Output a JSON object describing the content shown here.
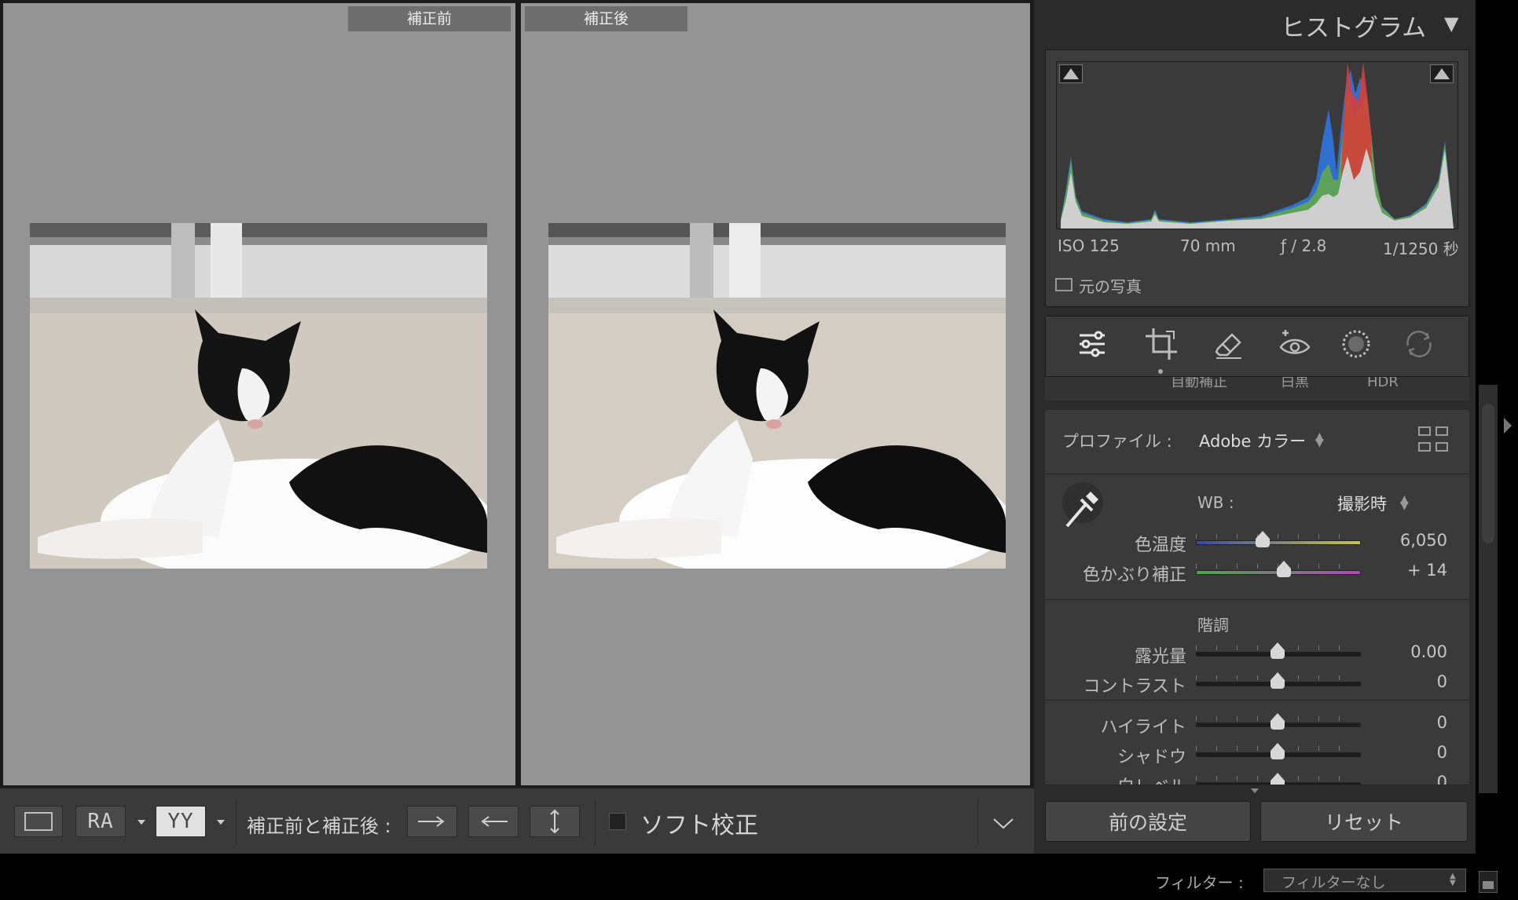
{
  "compare": {
    "before_label": "補正前",
    "after_label": "補正後"
  },
  "toolbar": {
    "ra_letters": "RA",
    "yy_letters": "YY",
    "compare_label": "補正前と補正後 :",
    "soft_proof_label": "ソフト校正"
  },
  "panel": {
    "histogram_title": "ヒストグラム",
    "histogram_toggle": "▼",
    "meta": {
      "iso": "ISO 125",
      "focal": "70 mm",
      "aperture": "ƒ / 2.8",
      "shutter": "1/1250 秒"
    },
    "original_photo_label": "元の写真",
    "peek_labels": [
      "自動補正",
      "白黒",
      "HDR"
    ],
    "profile": {
      "label": "プロファイル :",
      "value": "Adobe カラー"
    },
    "wb": {
      "label": "WB :",
      "value": "撮影時"
    },
    "sliders_wb": [
      {
        "label": "色温度",
        "value": "6,050",
        "position": 0.41
      },
      {
        "label": "色かぶり補正",
        "value": "+ 14",
        "position": 0.54
      }
    ],
    "tone_header": "階調",
    "sliders_tone": [
      {
        "label": "露光量",
        "value": "0.00",
        "position": 0.5
      },
      {
        "label": "コントラスト",
        "value": "0",
        "position": 0.5
      }
    ],
    "sliders_presence": [
      {
        "label": "ハイライト",
        "value": "0",
        "position": 0.5
      },
      {
        "label": "シャドウ",
        "value": "0",
        "position": 0.5
      },
      {
        "label": "白レベル",
        "value": "0",
        "position": 0.5
      }
    ],
    "prev_settings_button": "前の設定",
    "reset_button": "リセット"
  },
  "status": {
    "filter_label": "フィルター :",
    "filter_value": "フィルターなし"
  },
  "colors": {
    "pane_bg": "#949494",
    "panel_bg": "#3a3a3a",
    "hist_blue": "#2f6fd0",
    "hist_green": "#5ea25a",
    "hist_red": "#d4403a"
  }
}
